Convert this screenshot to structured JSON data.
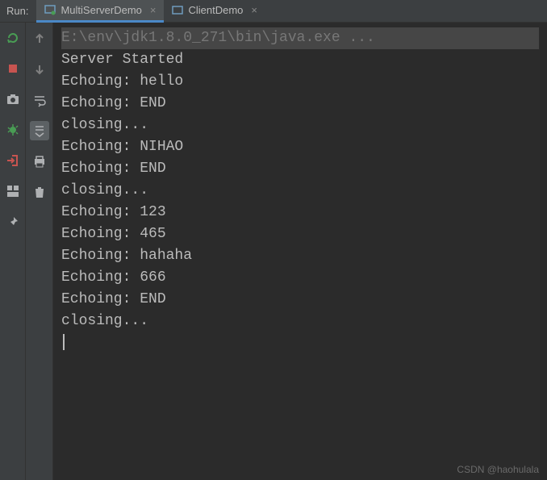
{
  "panel_label": "Run:",
  "tabs": [
    {
      "label": "MultiServerDemo",
      "active": true
    },
    {
      "label": "ClientDemo",
      "active": false
    }
  ],
  "left_toolbar": {
    "rerun": "rerun-icon",
    "stop": "stop-icon",
    "camera": "camera-icon",
    "debug": "debug-icon",
    "exit": "exit-icon",
    "layout": "layout-icon",
    "pin": "pin-icon"
  },
  "second_toolbar": {
    "up": "arrow-up-icon",
    "down": "arrow-down-icon",
    "wrap": "soft-wrap-icon",
    "scroll": "scroll-to-end-icon",
    "print": "print-icon",
    "trash": "trash-icon"
  },
  "console": {
    "command_line": "E:\\env\\jdk1.8.0_271\\bin\\java.exe ...",
    "lines": [
      "Server Started",
      "Echoing: hello",
      "Echoing: END",
      "closing...",
      "Echoing: NIHAO",
      "Echoing: END",
      "closing...",
      "Echoing: 123",
      "Echoing: 465",
      "Echoing: hahaha",
      "Echoing: 666",
      "Echoing: END",
      "closing..."
    ]
  },
  "watermark": "CSDN @haohulala"
}
